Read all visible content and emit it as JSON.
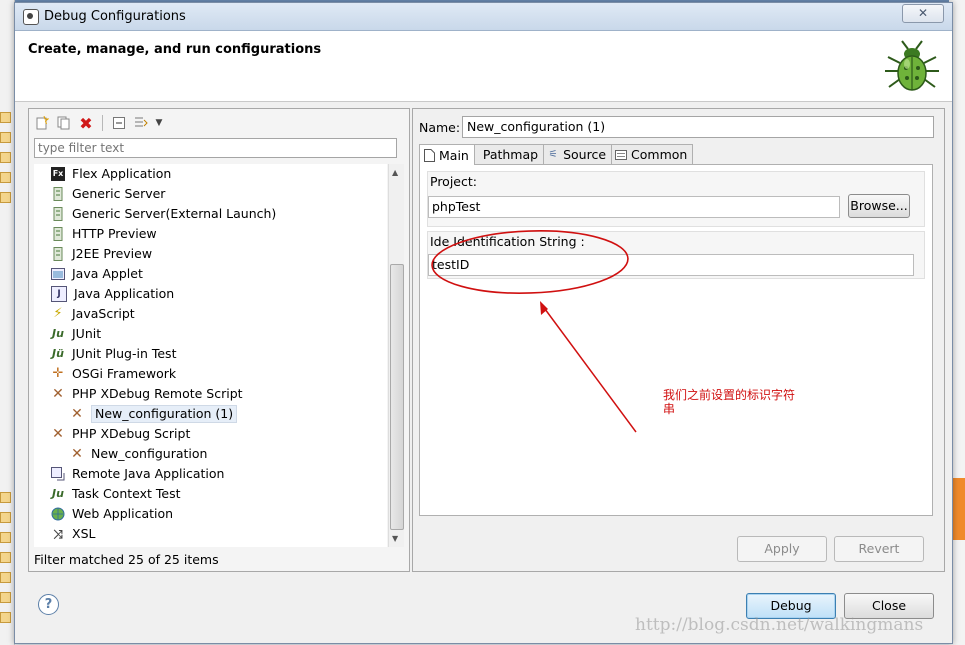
{
  "window": {
    "title": "Debug Configurations"
  },
  "header": {
    "text": "Create, manage, and run configurations"
  },
  "left": {
    "filter_placeholder": "type filter text",
    "status": "Filter matched 25 of 25 items",
    "items": [
      {
        "label": "Flex Application",
        "icon": "fx-icon"
      },
      {
        "label": "Generic Server",
        "icon": "server-icon"
      },
      {
        "label": "Generic Server(External Launch)",
        "icon": "server-icon"
      },
      {
        "label": "HTTP Preview",
        "icon": "server-icon"
      },
      {
        "label": "J2EE Preview",
        "icon": "server-icon"
      },
      {
        "label": "Java Applet",
        "icon": "applet-icon"
      },
      {
        "label": "Java Application",
        "icon": "java-app-icon"
      },
      {
        "label": "JavaScript",
        "icon": "javascript-icon"
      },
      {
        "label": "JUnit",
        "icon": "junit-icon"
      },
      {
        "label": "JUnit Plug-in Test",
        "icon": "junit-plugin-icon"
      },
      {
        "label": "OSGi Framework",
        "icon": "osgi-icon"
      },
      {
        "label": "PHP XDebug Remote Script",
        "icon": "xdebug-icon"
      },
      {
        "label": "New_configuration (1)",
        "icon": "xdebug-icon"
      },
      {
        "label": "PHP XDebug Script",
        "icon": "xdebug-icon"
      },
      {
        "label": "New_configuration",
        "icon": "xdebug-icon"
      },
      {
        "label": "Remote Java Application",
        "icon": "remote-java-icon"
      },
      {
        "label": "Task Context Test",
        "icon": "junit-icon"
      },
      {
        "label": "Web Application",
        "icon": "globe-icon"
      },
      {
        "label": "XSL",
        "icon": "xsl-icon"
      }
    ]
  },
  "right": {
    "name_label": "Name:",
    "name_value": "New_configuration (1)",
    "tabs": [
      "Main",
      "Pathmap",
      "Source",
      "Common"
    ],
    "project_label": "Project:",
    "project_value": "phpTest",
    "browse_label": "Browse...",
    "ide_label": "Ide Identification String :",
    "ide_value": "testID",
    "apply_label": "Apply",
    "revert_label": "Revert"
  },
  "buttons": {
    "help": "?",
    "debug": "Debug",
    "close": "Close"
  },
  "annotation": {
    "text": "我们之前设置的标识字符串",
    "color": "#d01010"
  },
  "watermark": "http://blog.csdn.net/walkingmans"
}
